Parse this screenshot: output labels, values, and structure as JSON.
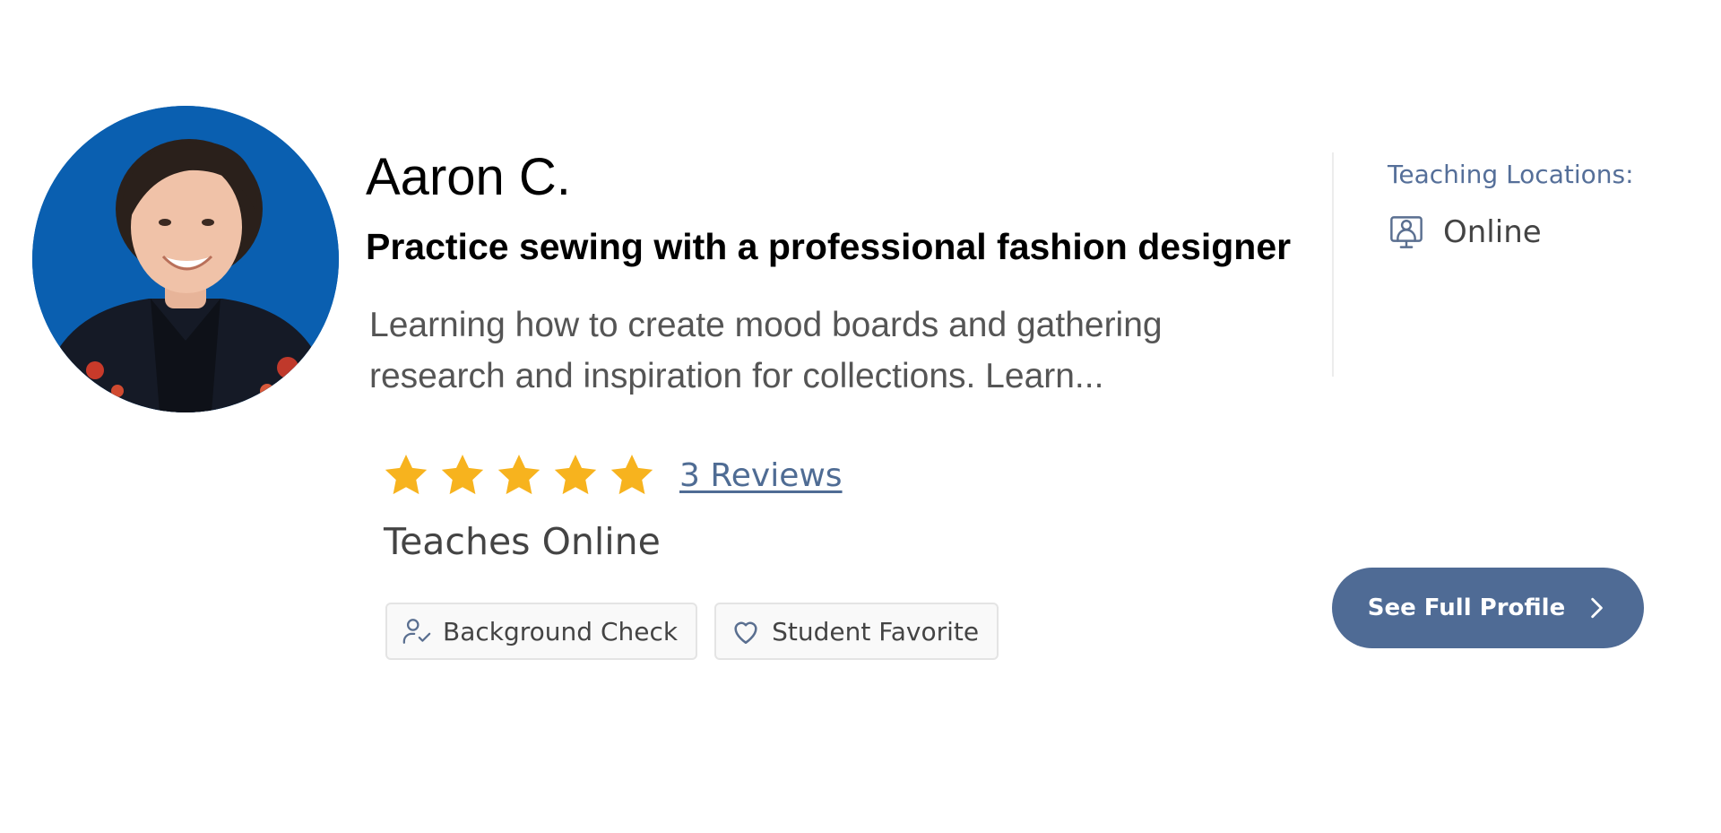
{
  "tutor": {
    "name": "Aaron C.",
    "headline": "Practice sewing with a professional fashion designer",
    "description": "Learning how to create mood boards and gathering research and inspiration for collections. Learn..."
  },
  "rating": {
    "stars": 5,
    "max_stars": 5,
    "reviews_label": "3 Reviews",
    "star_color": "#f7b31e"
  },
  "teaches": "Teaches Online",
  "badges": [
    {
      "icon": "person-check-icon",
      "label": "Background Check"
    },
    {
      "icon": "heart-icon",
      "label": "Student Favorite"
    }
  ],
  "locations": {
    "title": "Teaching Locations:",
    "items": [
      {
        "icon": "online-lesson-icon",
        "label": "Online"
      }
    ]
  },
  "cta": {
    "label": "See Full Profile",
    "icon": "chevron-right-icon",
    "color": "#4f6b95"
  }
}
